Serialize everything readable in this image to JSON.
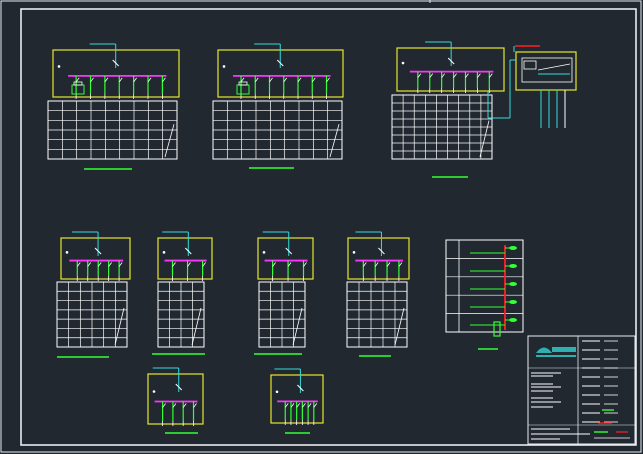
{
  "colors": {
    "background": "#212830",
    "frame": "#e8ecef",
    "line": "#ffffff",
    "panel": "#e6e62a",
    "busbar": "#ff33ff",
    "feeder": "#33ff33",
    "incoming": "#33dddd",
    "alert": "#ff2020",
    "logo": "#2fb0b0"
  },
  "icons": {
    "grid_table": "grid-table-icon",
    "switch": "switch-icon",
    "logo": "company-logo-icon"
  },
  "panels": [
    {
      "name": "distribution-panel-1",
      "feeders": 7,
      "meter": true,
      "table_rows": 6,
      "table_cols": 9
    },
    {
      "name": "distribution-panel-2",
      "feeders": 7,
      "meter": true,
      "table_rows": 6,
      "table_cols": 9
    },
    {
      "name": "distribution-panel-3",
      "feeders": 7,
      "meter": false,
      "table_rows": 8,
      "table_cols": 9
    },
    {
      "name": "distribution-panel-4",
      "feeders": 5,
      "meter": false,
      "table_rows": 7,
      "table_cols": 6
    },
    {
      "name": "distribution-panel-5",
      "feeders": 3,
      "meter": false,
      "table_rows": 7,
      "table_cols": 4
    },
    {
      "name": "distribution-panel-6",
      "feeders": 3,
      "meter": false,
      "table_rows": 7,
      "table_cols": 4
    },
    {
      "name": "distribution-panel-7",
      "feeders": 4,
      "meter": false,
      "table_rows": 7,
      "table_cols": 5
    },
    {
      "name": "distribution-panel-8",
      "feeders": 4,
      "meter": false,
      "table_rows": 0,
      "table_cols": 0
    },
    {
      "name": "distribution-panel-9",
      "feeders": 6,
      "meter": false,
      "table_rows": 0,
      "table_cols": 0
    }
  ],
  "riser": {
    "levels": 5
  }
}
